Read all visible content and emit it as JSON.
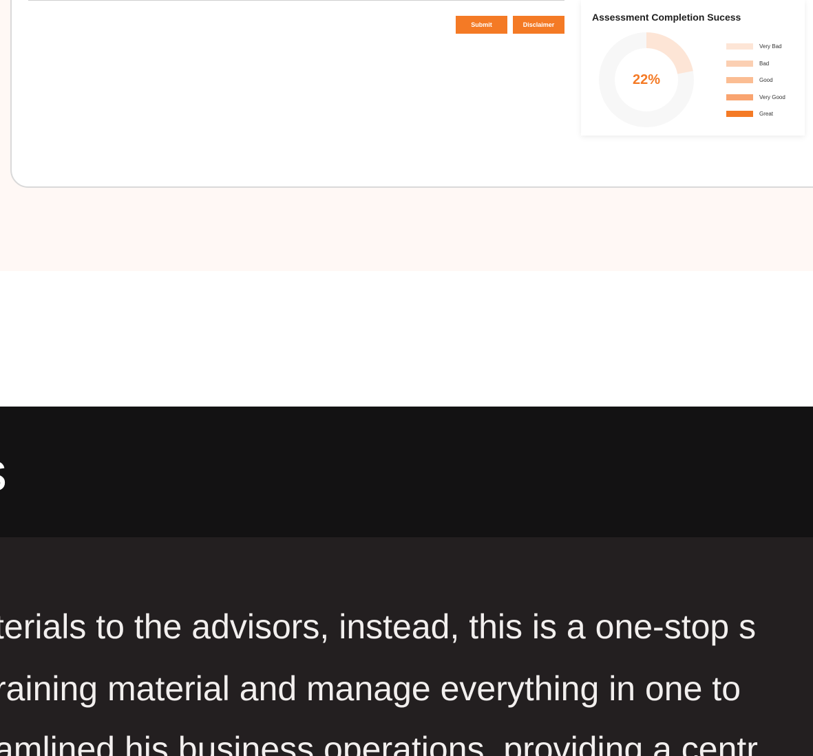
{
  "actions": {
    "submit_label": "Submit",
    "disclaimer_label": "Disclaimer"
  },
  "assessment": {
    "title": "Assessment Completion Sucess",
    "percent_label": "22%",
    "percent_value": 22,
    "legend": [
      {
        "label": "Very Bad",
        "color": "#fde5d6"
      },
      {
        "label": "Bad",
        "color": "#fbcfb2"
      },
      {
        "label": "Good",
        "color": "#fbbd93"
      },
      {
        "label": "Very Good",
        "color": "#f9a470"
      },
      {
        "label": "Great",
        "color": "#f47a25"
      }
    ],
    "donut_track_color": "#f7f7f7",
    "donut_fill_color": "#fde5d6"
  },
  "band": {
    "heading_fragment": "s"
  },
  "body": {
    "line_1": "terials to the advisors, instead, this is a one-stop s",
    "line_2": "raining material and manage everything in one to",
    "line_3": "amlined his business operations, providing a centr"
  },
  "colors": {
    "accent": "#f47a25",
    "top_background": "#fff8f5",
    "band_background": "#131213",
    "dark_background": "#231f20"
  }
}
